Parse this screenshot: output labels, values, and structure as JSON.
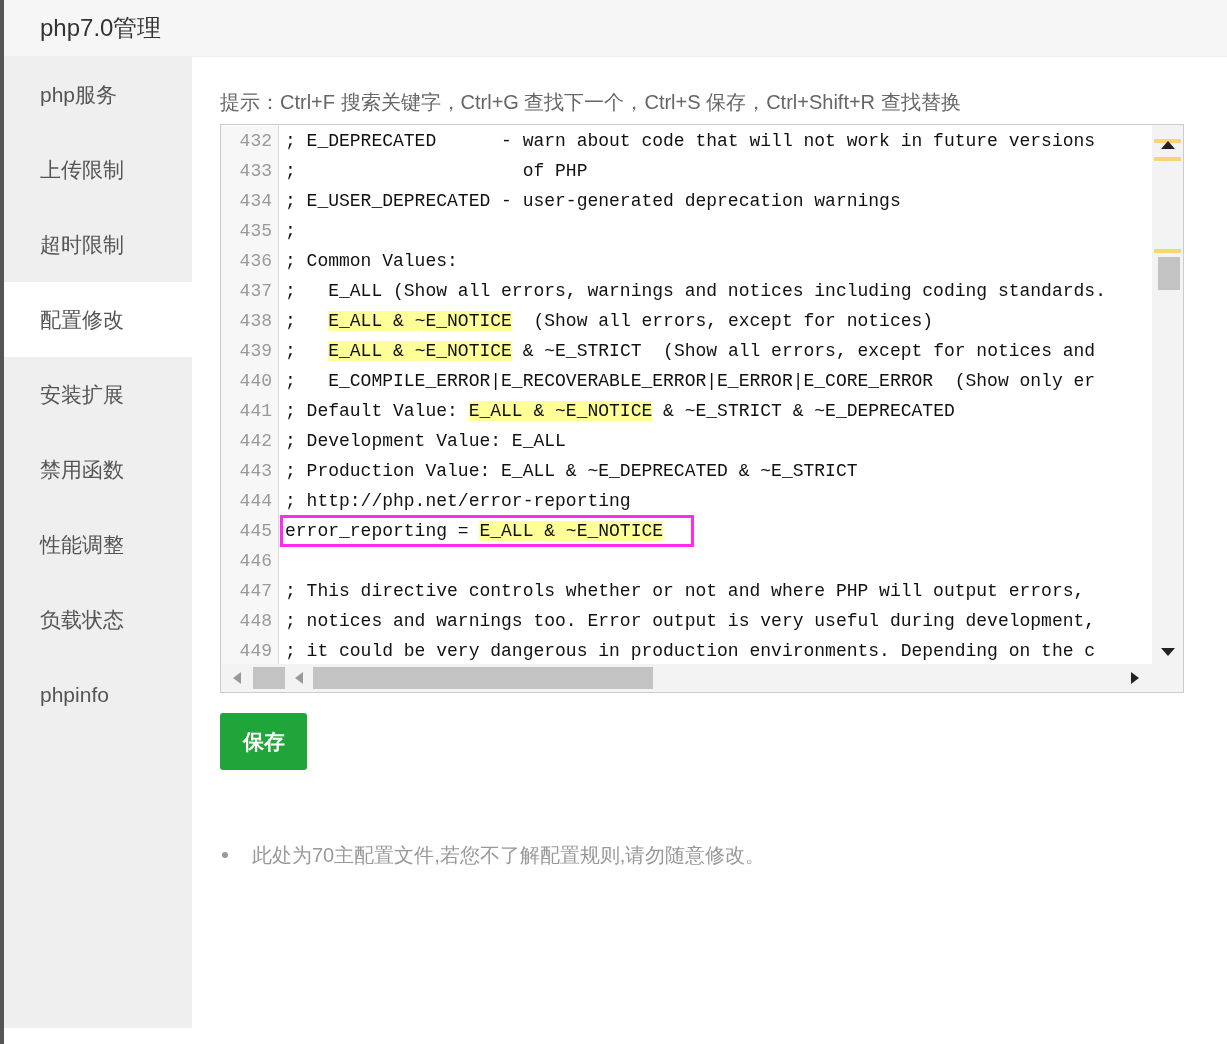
{
  "window": {
    "title": "php7.0管理"
  },
  "sidebar": {
    "items": [
      {
        "label": "php服务",
        "selected": false
      },
      {
        "label": "上传限制",
        "selected": false
      },
      {
        "label": "超时限制",
        "selected": false
      },
      {
        "label": "配置修改",
        "selected": true
      },
      {
        "label": "安装扩展",
        "selected": false
      },
      {
        "label": "禁用函数",
        "selected": false
      },
      {
        "label": "性能调整",
        "selected": false
      },
      {
        "label": "负载状态",
        "selected": false
      },
      {
        "label": "phpinfo",
        "selected": false
      }
    ]
  },
  "hint": "提示：Ctrl+F 搜索关键字，Ctrl+G 查找下一个，Ctrl+S 保存，Ctrl+Shift+R 查找替换",
  "editor": {
    "lines": [
      {
        "number": "432",
        "boxed": false,
        "segments": [
          {
            "text": "; E_DEPRECATED      - warn about code that will not work in future versions",
            "highlighted": false
          }
        ]
      },
      {
        "number": "433",
        "boxed": false,
        "segments": [
          {
            "text": ";                     of PHP",
            "highlighted": false
          }
        ]
      },
      {
        "number": "434",
        "boxed": false,
        "segments": [
          {
            "text": "; E_USER_DEPRECATED - user-generated deprecation warnings",
            "highlighted": false
          }
        ]
      },
      {
        "number": "435",
        "boxed": false,
        "segments": [
          {
            "text": ";",
            "highlighted": false
          }
        ]
      },
      {
        "number": "436",
        "boxed": false,
        "segments": [
          {
            "text": "; Common Values:",
            "highlighted": false
          }
        ]
      },
      {
        "number": "437",
        "boxed": false,
        "segments": [
          {
            "text": ";   E_ALL (Show all errors, warnings and notices including coding standards.",
            "highlighted": false
          }
        ]
      },
      {
        "number": "438",
        "boxed": false,
        "segments": [
          {
            "text": ";   ",
            "highlighted": false
          },
          {
            "text": "E_ALL & ~E_NOTICE",
            "highlighted": true
          },
          {
            "text": "  (Show all errors, except for notices)",
            "highlighted": false
          }
        ]
      },
      {
        "number": "439",
        "boxed": false,
        "segments": [
          {
            "text": ";   ",
            "highlighted": false
          },
          {
            "text": "E_ALL & ~E_NOTICE",
            "highlighted": true
          },
          {
            "text": " & ~E_STRICT  (Show all errors, except for notices and",
            "highlighted": false
          }
        ]
      },
      {
        "number": "440",
        "boxed": false,
        "segments": [
          {
            "text": ";   E_COMPILE_ERROR|E_RECOVERABLE_ERROR|E_ERROR|E_CORE_ERROR  (Show only er",
            "highlighted": false
          }
        ]
      },
      {
        "number": "441",
        "boxed": false,
        "segments": [
          {
            "text": "; Default Value: ",
            "highlighted": false
          },
          {
            "text": "E_ALL & ~E_NOTICE",
            "highlighted": true
          },
          {
            "text": " & ~E_STRICT & ~E_DEPRECATED",
            "highlighted": false
          }
        ]
      },
      {
        "number": "442",
        "boxed": false,
        "segments": [
          {
            "text": "; Development Value: E_ALL",
            "highlighted": false
          }
        ]
      },
      {
        "number": "443",
        "boxed": false,
        "segments": [
          {
            "text": "; Production Value: E_ALL & ~E_DEPRECATED & ~E_STRICT",
            "highlighted": false
          }
        ]
      },
      {
        "number": "444",
        "boxed": false,
        "segments": [
          {
            "text": "; http://php.net/error-reporting",
            "highlighted": false
          }
        ]
      },
      {
        "number": "445",
        "boxed": true,
        "segments": [
          {
            "text": "error_reporting = ",
            "highlighted": false
          },
          {
            "text": "E_ALL & ~E_NOTICE",
            "highlighted": true
          }
        ]
      },
      {
        "number": "446",
        "boxed": false
      },
      {
        "number": "447",
        "boxed": false,
        "segments": [
          {
            "text": "; This directive controls whether or not and where PHP will output errors,",
            "highlighted": false
          }
        ]
      },
      {
        "number": "448",
        "boxed": false,
        "segments": [
          {
            "text": "; notices and warnings too. Error output is very useful during development,",
            "highlighted": false
          }
        ]
      },
      {
        "number": "449",
        "boxed": false,
        "segments": [
          {
            "text": "; it could be very dangerous in production environments. Depending on the c",
            "highlighted": false
          }
        ]
      }
    ]
  },
  "save_button": {
    "label": "保存"
  },
  "notes": [
    "此处为70主配置文件,若您不了解配置规则,请勿随意修改。"
  ]
}
